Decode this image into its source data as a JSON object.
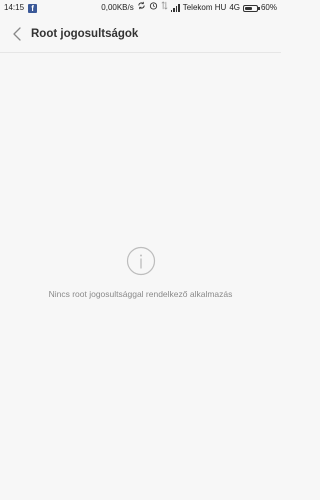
{
  "status_bar": {
    "time": "14:15",
    "network_speed": "0,00KB/s",
    "carrier": "Telekom HU",
    "network_type": "4G",
    "battery": "60%",
    "battery_level": 0.6,
    "notification_icon": "facebook-icon",
    "icons": [
      "sync-icon",
      "alarm-clock-icon",
      "data-transfer-icon",
      "signal-icon",
      "battery-icon"
    ]
  },
  "header": {
    "title": "Root jogosultságok",
    "back_icon": "chevron-left-icon"
  },
  "empty_state": {
    "icon": "info-icon",
    "message": "Nincs root jogosultsággal rendelkező alkalmazás"
  },
  "colors": {
    "background": "#f7f7f7",
    "title_text": "#333333",
    "message_text": "#8a8a8a",
    "icon_stroke": "#bdbdbd"
  }
}
